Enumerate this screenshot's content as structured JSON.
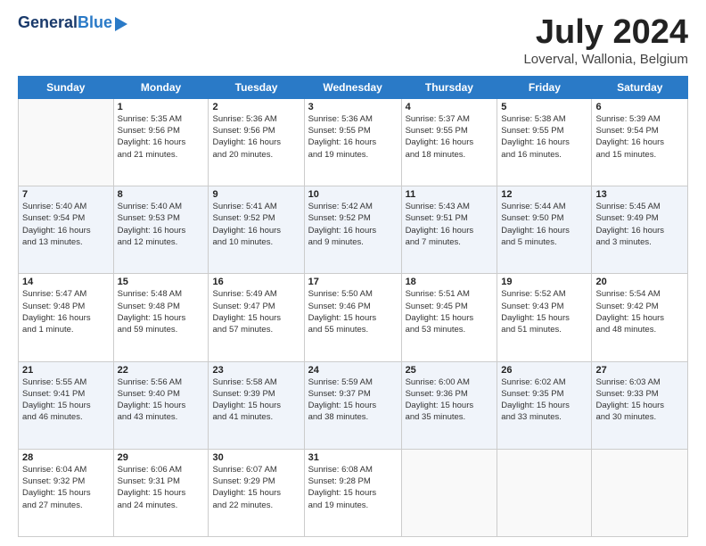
{
  "header": {
    "logo_line1": "General",
    "logo_line2": "Blue",
    "title": "July 2024",
    "subtitle": "Loverval, Wallonia, Belgium"
  },
  "columns": [
    "Sunday",
    "Monday",
    "Tuesday",
    "Wednesday",
    "Thursday",
    "Friday",
    "Saturday"
  ],
  "weeks": [
    {
      "alt": false,
      "days": [
        {
          "num": "",
          "info": ""
        },
        {
          "num": "1",
          "info": "Sunrise: 5:35 AM\nSunset: 9:56 PM\nDaylight: 16 hours\nand 21 minutes."
        },
        {
          "num": "2",
          "info": "Sunrise: 5:36 AM\nSunset: 9:56 PM\nDaylight: 16 hours\nand 20 minutes."
        },
        {
          "num": "3",
          "info": "Sunrise: 5:36 AM\nSunset: 9:55 PM\nDaylight: 16 hours\nand 19 minutes."
        },
        {
          "num": "4",
          "info": "Sunrise: 5:37 AM\nSunset: 9:55 PM\nDaylight: 16 hours\nand 18 minutes."
        },
        {
          "num": "5",
          "info": "Sunrise: 5:38 AM\nSunset: 9:55 PM\nDaylight: 16 hours\nand 16 minutes."
        },
        {
          "num": "6",
          "info": "Sunrise: 5:39 AM\nSunset: 9:54 PM\nDaylight: 16 hours\nand 15 minutes."
        }
      ]
    },
    {
      "alt": true,
      "days": [
        {
          "num": "7",
          "info": "Sunrise: 5:40 AM\nSunset: 9:54 PM\nDaylight: 16 hours\nand 13 minutes."
        },
        {
          "num": "8",
          "info": "Sunrise: 5:40 AM\nSunset: 9:53 PM\nDaylight: 16 hours\nand 12 minutes."
        },
        {
          "num": "9",
          "info": "Sunrise: 5:41 AM\nSunset: 9:52 PM\nDaylight: 16 hours\nand 10 minutes."
        },
        {
          "num": "10",
          "info": "Sunrise: 5:42 AM\nSunset: 9:52 PM\nDaylight: 16 hours\nand 9 minutes."
        },
        {
          "num": "11",
          "info": "Sunrise: 5:43 AM\nSunset: 9:51 PM\nDaylight: 16 hours\nand 7 minutes."
        },
        {
          "num": "12",
          "info": "Sunrise: 5:44 AM\nSunset: 9:50 PM\nDaylight: 16 hours\nand 5 minutes."
        },
        {
          "num": "13",
          "info": "Sunrise: 5:45 AM\nSunset: 9:49 PM\nDaylight: 16 hours\nand 3 minutes."
        }
      ]
    },
    {
      "alt": false,
      "days": [
        {
          "num": "14",
          "info": "Sunrise: 5:47 AM\nSunset: 9:48 PM\nDaylight: 16 hours\nand 1 minute."
        },
        {
          "num": "15",
          "info": "Sunrise: 5:48 AM\nSunset: 9:48 PM\nDaylight: 15 hours\nand 59 minutes."
        },
        {
          "num": "16",
          "info": "Sunrise: 5:49 AM\nSunset: 9:47 PM\nDaylight: 15 hours\nand 57 minutes."
        },
        {
          "num": "17",
          "info": "Sunrise: 5:50 AM\nSunset: 9:46 PM\nDaylight: 15 hours\nand 55 minutes."
        },
        {
          "num": "18",
          "info": "Sunrise: 5:51 AM\nSunset: 9:45 PM\nDaylight: 15 hours\nand 53 minutes."
        },
        {
          "num": "19",
          "info": "Sunrise: 5:52 AM\nSunset: 9:43 PM\nDaylight: 15 hours\nand 51 minutes."
        },
        {
          "num": "20",
          "info": "Sunrise: 5:54 AM\nSunset: 9:42 PM\nDaylight: 15 hours\nand 48 minutes."
        }
      ]
    },
    {
      "alt": true,
      "days": [
        {
          "num": "21",
          "info": "Sunrise: 5:55 AM\nSunset: 9:41 PM\nDaylight: 15 hours\nand 46 minutes."
        },
        {
          "num": "22",
          "info": "Sunrise: 5:56 AM\nSunset: 9:40 PM\nDaylight: 15 hours\nand 43 minutes."
        },
        {
          "num": "23",
          "info": "Sunrise: 5:58 AM\nSunset: 9:39 PM\nDaylight: 15 hours\nand 41 minutes."
        },
        {
          "num": "24",
          "info": "Sunrise: 5:59 AM\nSunset: 9:37 PM\nDaylight: 15 hours\nand 38 minutes."
        },
        {
          "num": "25",
          "info": "Sunrise: 6:00 AM\nSunset: 9:36 PM\nDaylight: 15 hours\nand 35 minutes."
        },
        {
          "num": "26",
          "info": "Sunrise: 6:02 AM\nSunset: 9:35 PM\nDaylight: 15 hours\nand 33 minutes."
        },
        {
          "num": "27",
          "info": "Sunrise: 6:03 AM\nSunset: 9:33 PM\nDaylight: 15 hours\nand 30 minutes."
        }
      ]
    },
    {
      "alt": false,
      "days": [
        {
          "num": "28",
          "info": "Sunrise: 6:04 AM\nSunset: 9:32 PM\nDaylight: 15 hours\nand 27 minutes."
        },
        {
          "num": "29",
          "info": "Sunrise: 6:06 AM\nSunset: 9:31 PM\nDaylight: 15 hours\nand 24 minutes."
        },
        {
          "num": "30",
          "info": "Sunrise: 6:07 AM\nSunset: 9:29 PM\nDaylight: 15 hours\nand 22 minutes."
        },
        {
          "num": "31",
          "info": "Sunrise: 6:08 AM\nSunset: 9:28 PM\nDaylight: 15 hours\nand 19 minutes."
        },
        {
          "num": "",
          "info": ""
        },
        {
          "num": "",
          "info": ""
        },
        {
          "num": "",
          "info": ""
        }
      ]
    }
  ]
}
